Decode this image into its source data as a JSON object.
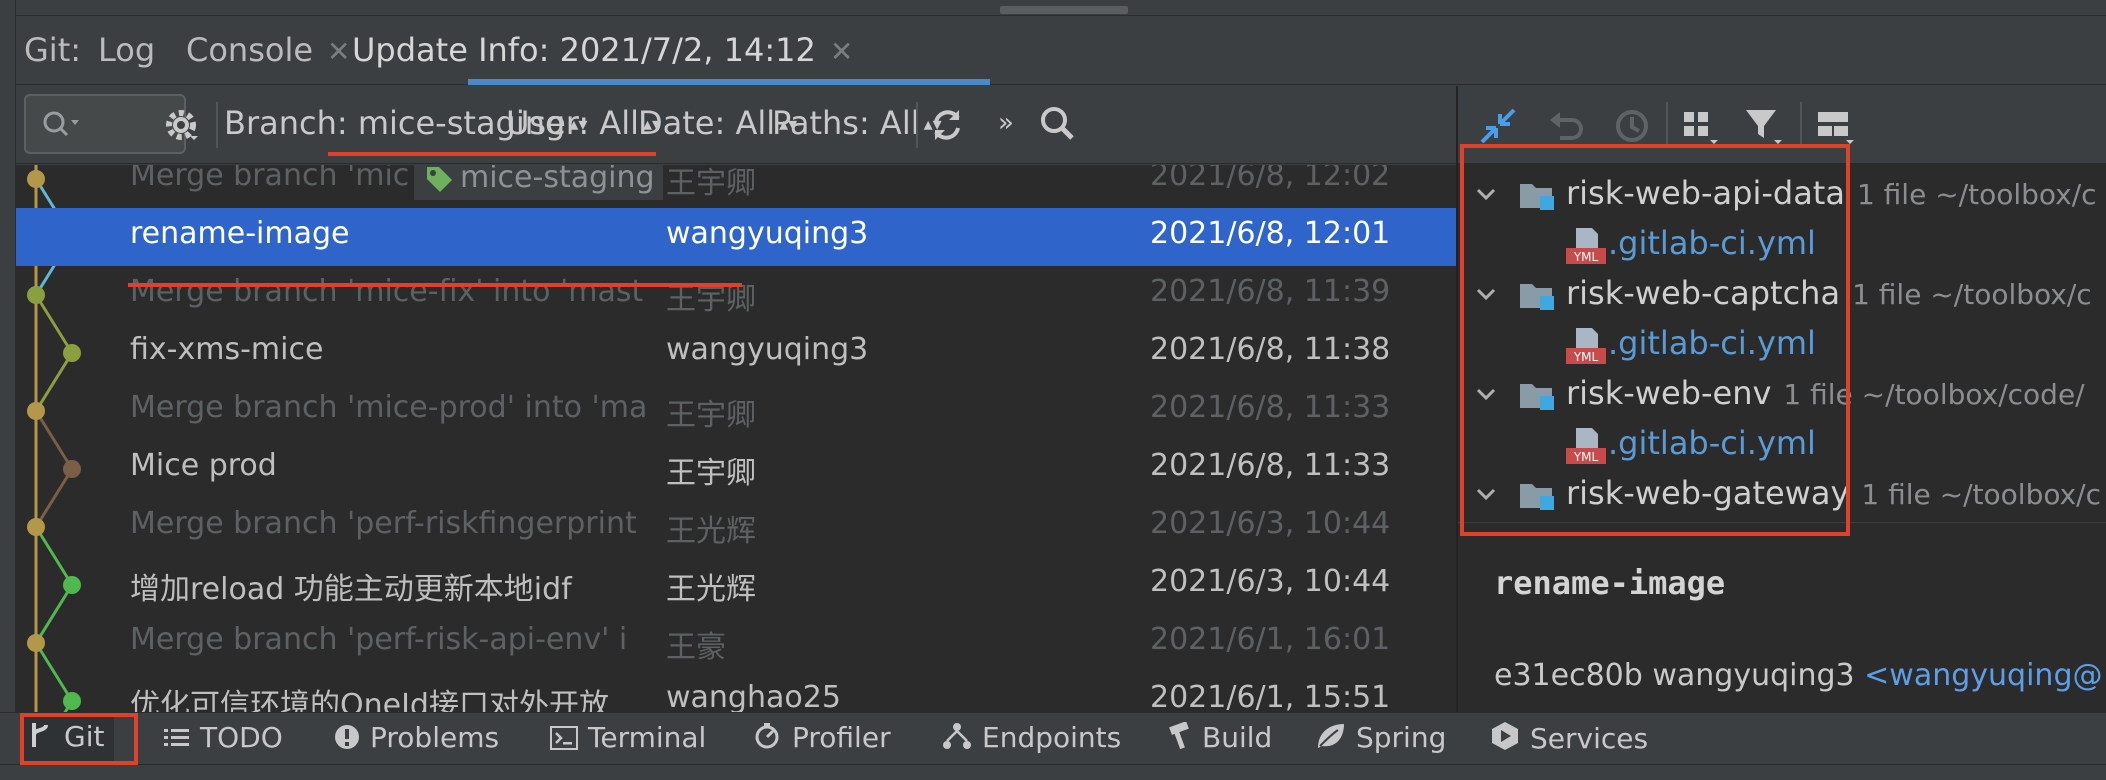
{
  "tabs": {
    "git_label": "Git:",
    "log": "Log",
    "console": "Console",
    "update_info": "Update Info: 2021/7/2, 14:12"
  },
  "toolbar": {
    "branch": "Branch: mice-staging",
    "user": "User: All",
    "date": "Date: All",
    "paths": "Paths: All"
  },
  "commits": [
    {
      "subject": "Merge branch 'mic",
      "author": "王宇卿",
      "date": "2021/6/8, 12:02",
      "tag": "mice-staging"
    },
    {
      "subject": "rename-image",
      "author": "wangyuqing3",
      "date": "2021/6/8, 12:01"
    },
    {
      "subject": "Merge branch 'mice-fix' into 'mast",
      "author": "王宇卿",
      "date": "2021/6/8, 11:39"
    },
    {
      "subject": "fix-xms-mice",
      "author": "wangyuqing3",
      "date": "2021/6/8, 11:38"
    },
    {
      "subject": "Merge branch 'mice-prod' into 'ma",
      "author": "王宇卿",
      "date": "2021/6/8, 11:33"
    },
    {
      "subject": "Mice prod",
      "author": "王宇卿",
      "date": "2021/6/8, 11:33"
    },
    {
      "subject": "Merge branch 'perf-riskfingerprint",
      "author": "王光辉",
      "date": "2021/6/3, 10:44"
    },
    {
      "subject": "增加reload 功能主动更新本地idf",
      "author": "王光辉",
      "date": "2021/6/3, 10:44"
    },
    {
      "subject": "Merge branch 'perf-risk-api-env' i",
      "author": "王豪",
      "date": "2021/6/1, 16:01"
    },
    {
      "subject": "优化可信环境的OneId接口对外开放",
      "author": "wanghao25",
      "date": "2021/6/1, 15:51"
    }
  ],
  "changed_files": [
    {
      "module": "risk-web-api-data",
      "info": "1 file  ~/toolbox/c",
      "file": ".gitlab-ci.yml"
    },
    {
      "module": "risk-web-captcha",
      "info": "1 file  ~/toolbox/c",
      "file": ".gitlab-ci.yml"
    },
    {
      "module": "risk-web-env",
      "info": "1 file  ~/toolbox/code/",
      "file": ".gitlab-ci.yml"
    },
    {
      "module": "risk-web-gateway",
      "info": "1 file  ~/toolbox/c"
    }
  ],
  "details": {
    "title": "rename-image",
    "hash": "e31ec80b",
    "author": "wangyuqing3",
    "email": "<wangyuqing@"
  },
  "bottom_tools": {
    "git": "Git",
    "todo": "TODO",
    "problems": "Problems",
    "terminal": "Terminal",
    "profiler": "Profiler",
    "endpoints": "Endpoints",
    "build": "Build",
    "spring": "Spring",
    "services": "Services"
  },
  "colors": {
    "accent": "#2f65ca",
    "highlight_border": "#e0412a",
    "link": "#5c9ee8"
  }
}
